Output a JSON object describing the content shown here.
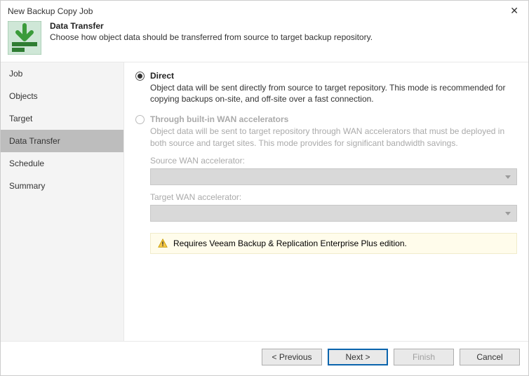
{
  "window": {
    "title": "New Backup Copy Job"
  },
  "header": {
    "title": "Data Transfer",
    "subtitle": "Choose how object data should be transferred from source to target backup repository."
  },
  "sidebar": {
    "items": [
      {
        "label": "Job"
      },
      {
        "label": "Objects"
      },
      {
        "label": "Target"
      },
      {
        "label": "Data Transfer"
      },
      {
        "label": "Schedule"
      },
      {
        "label": "Summary"
      }
    ],
    "active_index": 3
  },
  "options": {
    "direct": {
      "label": "Direct",
      "desc": "Object data will be sent directly from source to target repository. This mode is recommended for copying backups on-site, and off-site over a fast connection.",
      "selected": true
    },
    "wan": {
      "label": "Through built-in WAN accelerators",
      "desc": "Object data will be sent to target repository through WAN accelerators that must be deployed in both source and target sites. This mode provides for significant bandwidth savings.",
      "source_label": "Source WAN accelerator:",
      "target_label": "Target WAN accelerator:",
      "enabled": false
    }
  },
  "banner": {
    "text": "Requires Veeam Backup & Replication Enterprise Plus edition."
  },
  "footer": {
    "previous": "< Previous",
    "next": "Next >",
    "finish": "Finish",
    "cancel": "Cancel"
  }
}
